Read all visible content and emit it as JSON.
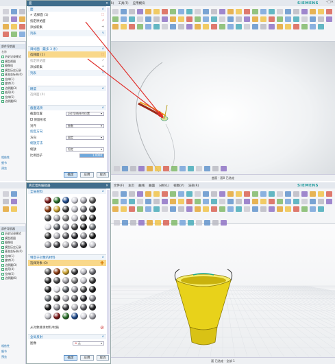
{
  "top": {
    "window_title": "NX 10 - 建模",
    "menus": [
      "文件(F)",
      "主页",
      "曲线",
      "曲面",
      "分析(L)",
      "视图(V)",
      "渲染(R)",
      "工具(T)",
      "应用模块"
    ],
    "brand": "SIEMENS",
    "sidebar": {
      "title": "部件导航器",
      "col_name": "名称",
      "items": [
        "历史记录模式",
        "模型视图",
        "摄像机",
        "模型历史记录",
        "基准坐标系(0)",
        "拉伸(1)",
        "旋转(2)",
        "边倒圆(3)",
        "抽壳(4)",
        "拉伸(5)",
        "边倒圆(6)"
      ],
      "bottom": [
        "相依性",
        "细节",
        "预览"
      ]
    },
    "dialog": {
      "title": "面",
      "sec_face": "面",
      "face_select": "选择面 (1)",
      "add_new": "指定原始面",
      "add_set": "添加新集",
      "list": "列表",
      "sec_target": "目标面（最多 3 条）",
      "target_select": "选择面 (1)",
      "target_origin": "指定原始面",
      "target_add": "添加新集",
      "target_list": "列表",
      "sec_smooth": "精度",
      "select_face": "选择面 (0)",
      "sec_section": "截面选项",
      "position_label": "截面位置",
      "position_value": "沿引导线任何位置",
      "end_match": "保留形状",
      "align_label": "对齐",
      "align_value": "参数",
      "sec_direction": "指定方向",
      "direction_label": "方向",
      "direction_value": "固定",
      "sec_scale": "缩放方法",
      "scale_label": "缩放",
      "scale_value": "恒定",
      "ratio_label": "比例因子",
      "ratio_value": "1.0000",
      "ok": "确定",
      "apply": "应用",
      "cancel": "取消"
    },
    "status_text": "曲面 - 面0 已选定"
  },
  "bottom": {
    "window_title": "NX 10 - 真实着色编辑器",
    "sidebar_title": "部件导航器",
    "dialog": {
      "title": "真实着色编辑器",
      "sec_global": "全局材料",
      "sec_object": "特定于对象的材料",
      "select_objects": "选择对象 (0)",
      "inherit": "从对象继承材料/材质",
      "sec_background": "全局反射",
      "image_label": "图像",
      "image_value": "无",
      "ok": "确定",
      "apply": "应用",
      "cancel": "取消"
    },
    "status_text": "面 已选定 - 全部 1"
  },
  "colors": {
    "title_bar": "#3f6d8c",
    "highlight": "#f9d88a",
    "arrow": "#e0302c",
    "bucket_yellow": "#e8d21a",
    "brand": "#1b9a9b"
  }
}
